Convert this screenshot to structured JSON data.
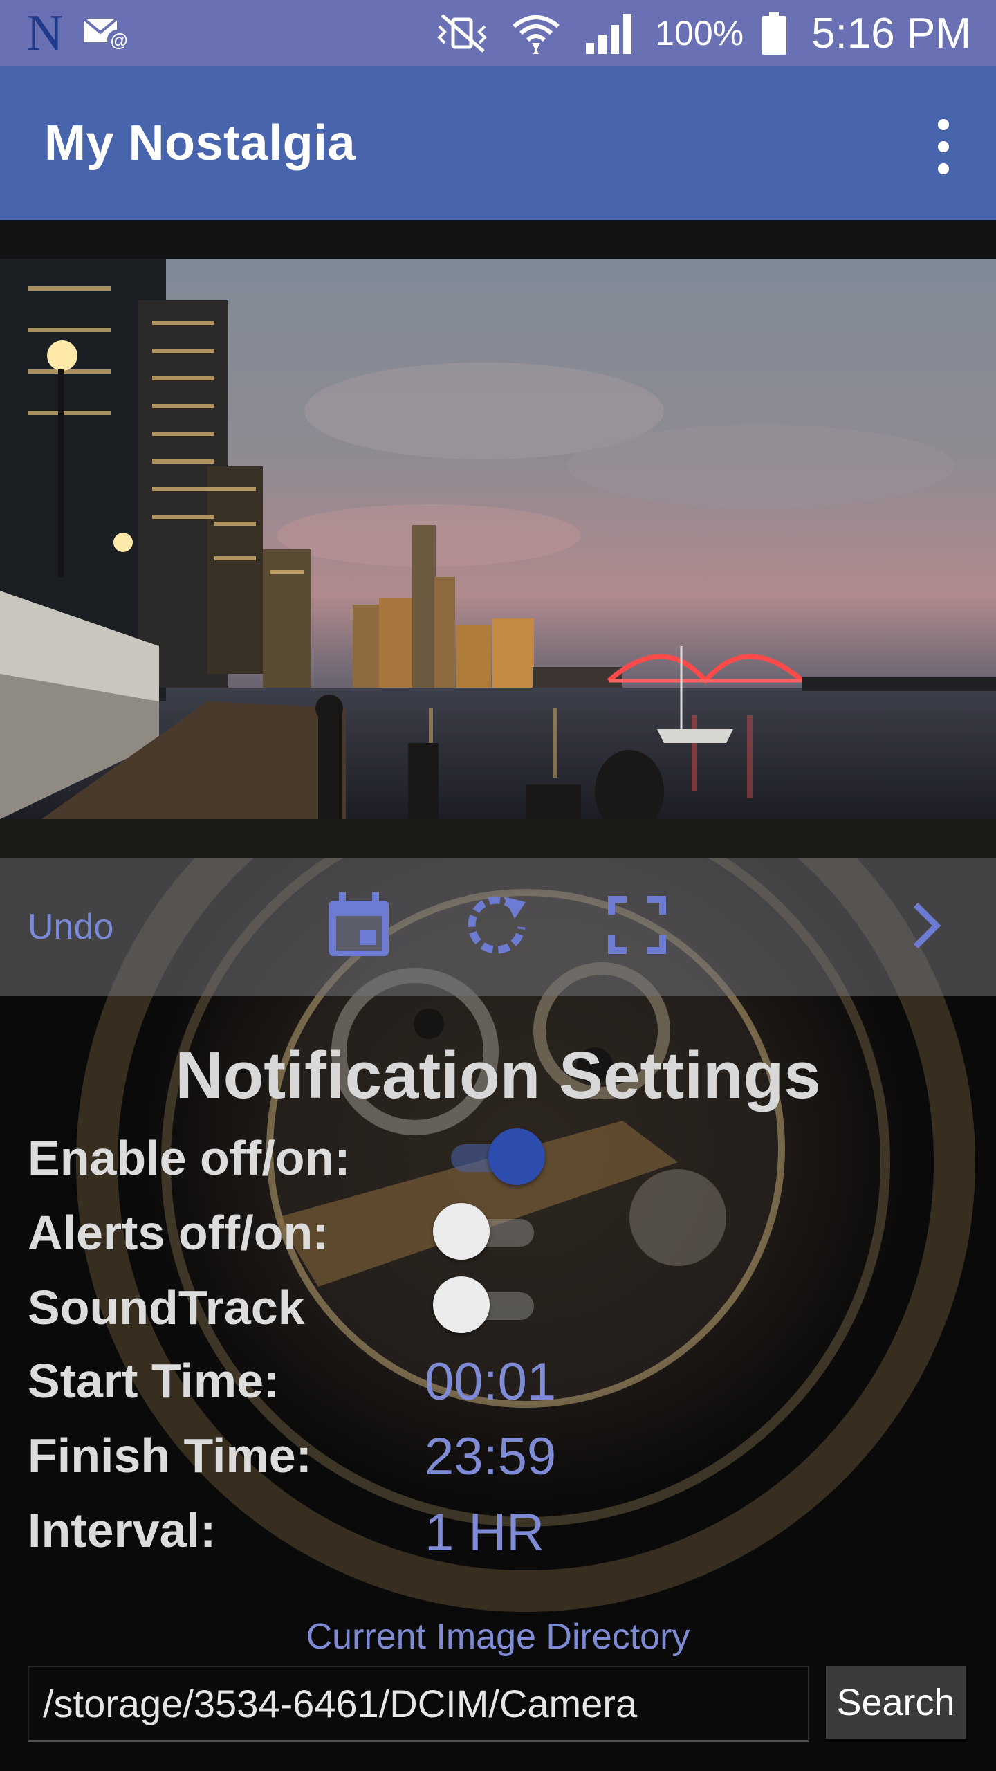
{
  "status_bar": {
    "battery": "100%",
    "time": "5:16 PM",
    "left_icons": [
      "n-logo-icon",
      "mail-icon"
    ],
    "right_icons": [
      "vibrate-off-icon",
      "wifi-icon",
      "signal-icon",
      "battery-icon"
    ]
  },
  "app_bar": {
    "title": "My Nostalgia",
    "menu_icon": "overflow-menu-icon"
  },
  "photo": {
    "description_icon": "city-night-photo"
  },
  "toolbar": {
    "undo_label": "Undo",
    "icons": [
      "calendar-icon",
      "refresh-icon",
      "fullscreen-icon",
      "chevron-right-icon"
    ]
  },
  "notification_settings": {
    "title": "Notification Settings",
    "enable_label": "Enable off/on:",
    "enable_state": true,
    "alerts_label": "Alerts off/on:",
    "alerts_state": false,
    "soundtrack_label": "SoundTrack",
    "soundtrack_state": false,
    "start_time_label": "Start Time:",
    "start_time": "00:01",
    "finish_time_label": "Finish Time:",
    "finish_time": "23:59",
    "interval_label": "Interval:",
    "interval": "1 HR"
  },
  "directory": {
    "label": "Current Image Directory",
    "path": "/storage/3534-6461/DCIM/Camera",
    "search_label": "Search"
  },
  "colors": {
    "status_bar": "#6a70b4",
    "app_bar": "#4864ad",
    "accent_text": "#7f8bd4",
    "toggle_on": "#2c4cae"
  }
}
